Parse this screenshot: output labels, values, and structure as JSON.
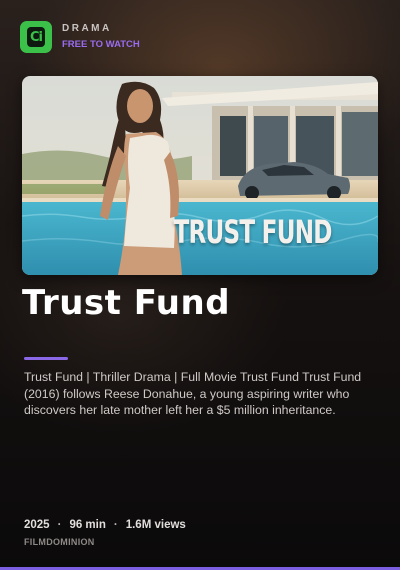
{
  "header": {
    "logo_text": "Ci",
    "category": "DRAMA",
    "badge": "FREE TO WATCH"
  },
  "thumbnail": {
    "overlay_title": "TRUST FUND"
  },
  "video": {
    "title": "Trust Fund",
    "description": "Trust Fund | Thriller Drama | Full Movie Trust Fund Trust Fund (2016) follows Reese Donahue, a young aspiring writer who discovers her late mother left her a $5 million inheritance.",
    "year": "2025",
    "duration": "96 min",
    "views": "1.6M views",
    "channel": "FILMDOMINION"
  },
  "colors": {
    "logo_green": "#3bc14a",
    "accent_purple": "#8a68e8",
    "badge_purple": "#9b6cf0"
  }
}
